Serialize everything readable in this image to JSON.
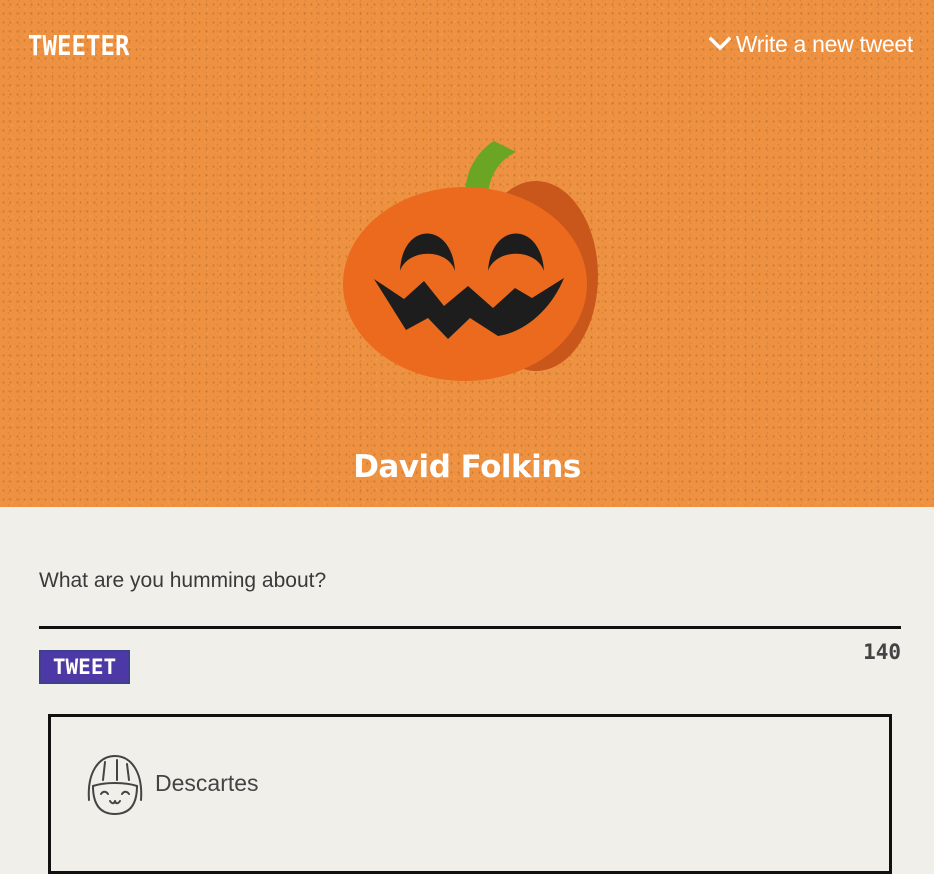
{
  "header": {
    "logo_text": "TWEETER",
    "compose_toggle_label": "Write a new tweet",
    "compose_toggle_icon": "chevron-down-icon"
  },
  "profile": {
    "name": "David Folkins",
    "avatar_icon": "jack-o-lantern-pumpkin-icon"
  },
  "composer": {
    "placeholder": "What are you humming about?",
    "value": "",
    "submit_label": "TWEET",
    "char_counter": "140"
  },
  "tweets": [
    {
      "author": "Descartes",
      "avatar_icon": "smiling-face-avatar-icon"
    }
  ],
  "colors": {
    "hero_background": "#ee9141",
    "page_background": "#f1efe9",
    "tweet_button": "#4d39a6",
    "pumpkin": "#ec6a1e",
    "pumpkin_shadow": "#c9561a",
    "stem": "#6aa623"
  }
}
